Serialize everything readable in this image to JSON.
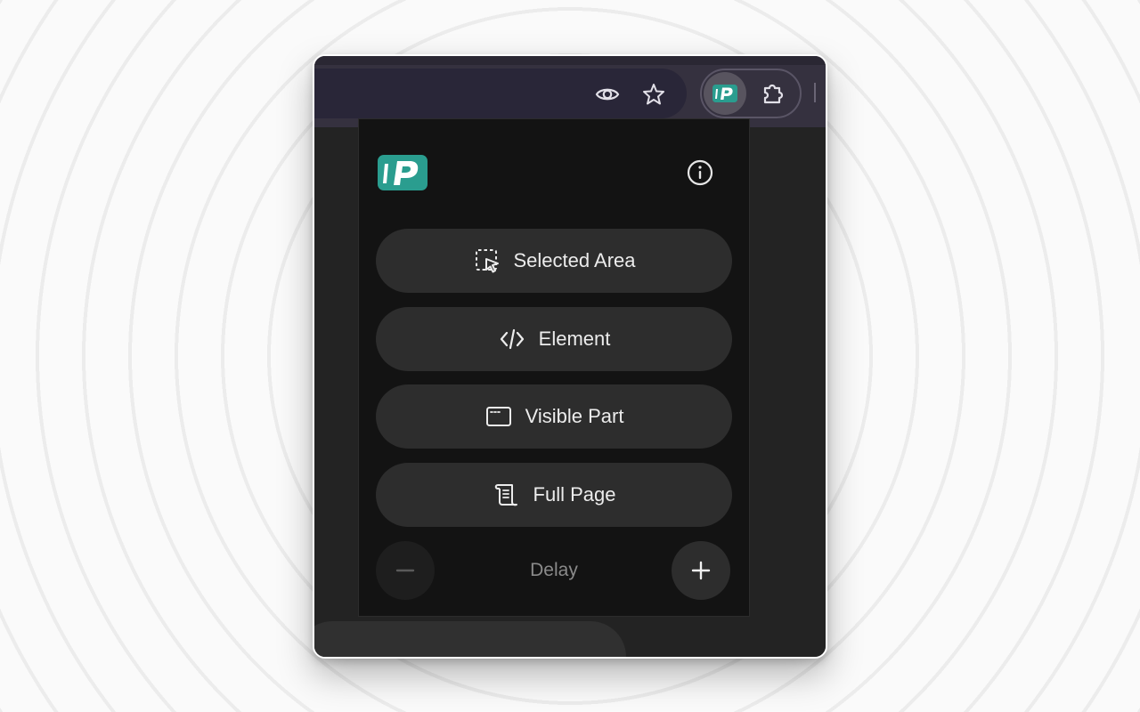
{
  "browser": {
    "omnibox_icons": [
      "eye-icon",
      "star-icon"
    ],
    "extension_icon": "pixel-logo-icon",
    "extensions_menu_icon": "puzzle-icon"
  },
  "popup": {
    "logo_icon": "pixel-logo-icon",
    "info_icon": "info-icon",
    "buttons": [
      {
        "label": "Selected Area",
        "icon": "selection-cursor-icon"
      },
      {
        "label": "Element",
        "icon": "code-brackets-icon"
      },
      {
        "label": "Visible Part",
        "icon": "window-icon"
      },
      {
        "label": "Full Page",
        "icon": "scroll-icon"
      }
    ],
    "delay": {
      "label": "Delay",
      "decrease_icon": "minus-icon",
      "increase_icon": "plus-icon"
    }
  },
  "colors": {
    "brand_teal": "#2a9d8f",
    "popup_bg": "#131313",
    "button_bg": "#2d2d2d",
    "toolbar_bg": "#35313f"
  }
}
